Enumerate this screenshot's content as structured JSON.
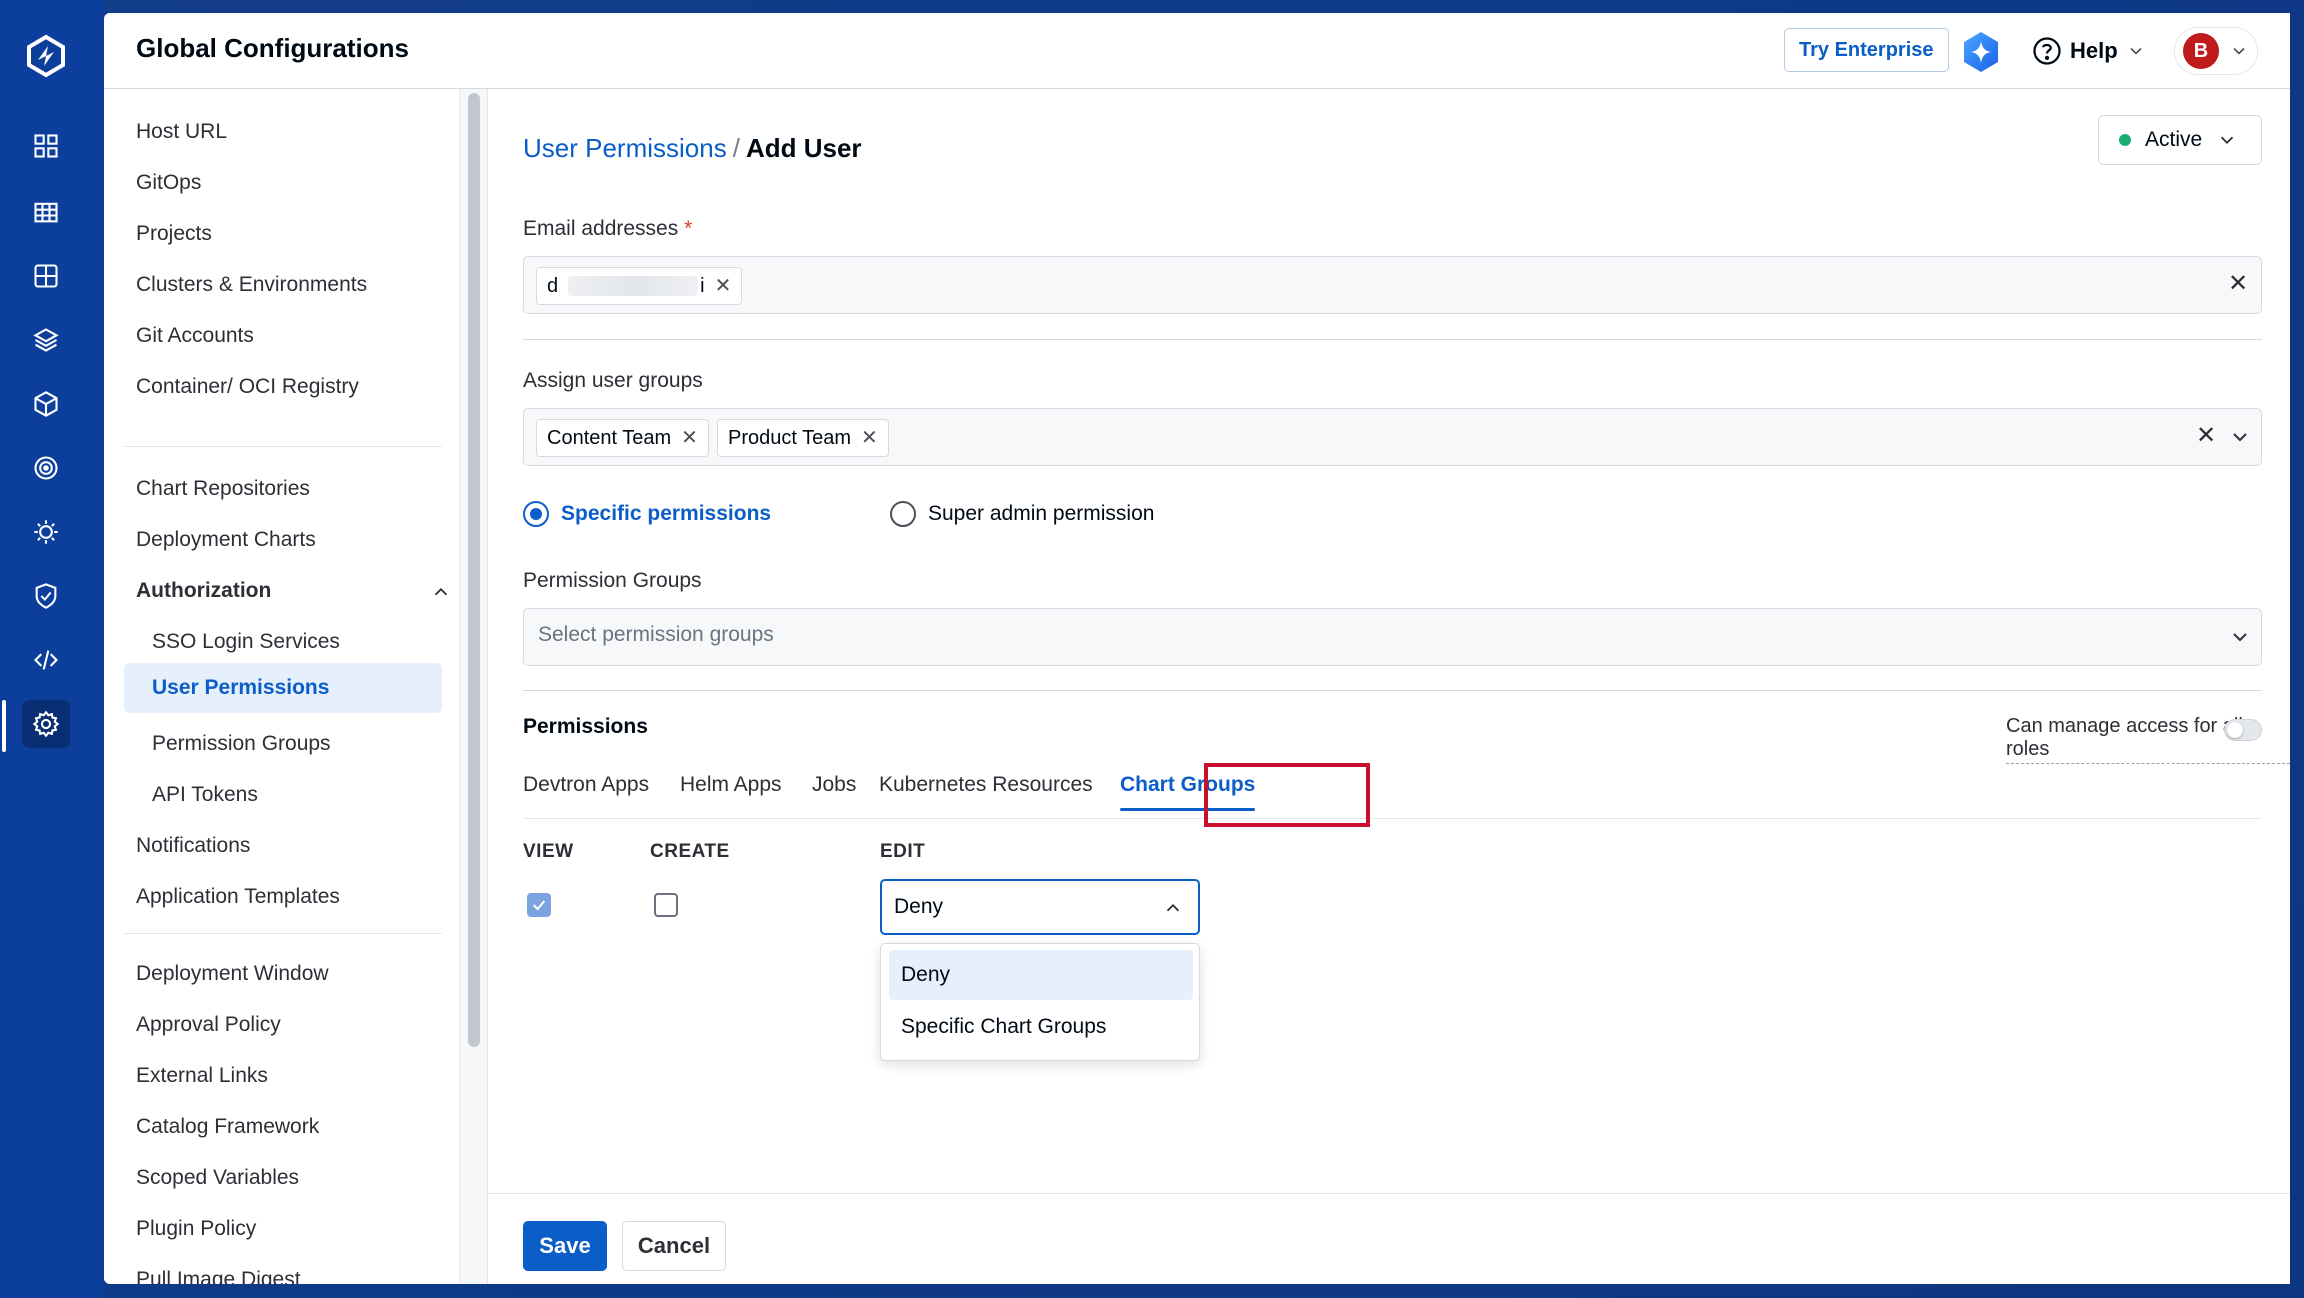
{
  "app": {
    "title": "Global Configurations",
    "try_enterprise": "Try Enterprise",
    "help": "Help",
    "avatar_initial": "B"
  },
  "rail": {
    "icons": [
      "apps-icon",
      "grid-icon",
      "dashboard-icon",
      "stack-icon",
      "cube-icon",
      "target-icon",
      "bug-icon",
      "shield-icon",
      "code-icon",
      "gear-icon"
    ]
  },
  "sidebar": {
    "items": [
      {
        "label": "Host URL"
      },
      {
        "label": "GitOps"
      },
      {
        "label": "Projects"
      },
      {
        "label": "Clusters & Environments"
      },
      {
        "label": "Git Accounts"
      },
      {
        "label": "Container/ OCI Registry"
      },
      {
        "label": "Chart Repositories"
      },
      {
        "label": "Deployment Charts"
      },
      {
        "label": "Authorization"
      },
      {
        "label": "SSO Login Services"
      },
      {
        "label": "User Permissions"
      },
      {
        "label": "Permission Groups"
      },
      {
        "label": "API Tokens"
      },
      {
        "label": "Notifications"
      },
      {
        "label": "Application Templates"
      },
      {
        "label": "Deployment Window"
      },
      {
        "label": "Approval Policy"
      },
      {
        "label": "External Links"
      },
      {
        "label": "Catalog Framework"
      },
      {
        "label": "Scoped Variables"
      },
      {
        "label": "Plugin Policy"
      },
      {
        "label": "Pull Image Digest"
      }
    ]
  },
  "breadcrumb": {
    "parent": "User Permissions",
    "separator": "/",
    "current": "Add User"
  },
  "status": {
    "label": "Active",
    "color": "#1dad70"
  },
  "email": {
    "label": "Email addresses",
    "required_mark": "*",
    "chip_start": "d",
    "chip_end": "i"
  },
  "groups": {
    "label": "Assign user groups",
    "chips": [
      "Content Team",
      "Product Team"
    ]
  },
  "permission_type": {
    "specific": "Specific permissions",
    "super_admin": "Super admin permission"
  },
  "permission_groups": {
    "label": "Permission Groups",
    "placeholder": "Select permission groups"
  },
  "permissions": {
    "title": "Permissions",
    "manage_all": "Can manage access for all roles",
    "tabs": [
      "Devtron Apps",
      "Helm Apps",
      "Jobs",
      "Kubernetes Resources",
      "Chart Groups"
    ],
    "active_tab": "Chart Groups",
    "columns": {
      "view": "VIEW",
      "create": "CREATE",
      "edit": "EDIT"
    },
    "edit_value": "Deny",
    "edit_options": [
      "Deny",
      "Specific Chart Groups"
    ]
  },
  "footer": {
    "save": "Save",
    "cancel": "Cancel"
  },
  "colors": {
    "accent": "#0b5dc8",
    "rail": "#0c3e9c",
    "highlight": "#c8102e"
  }
}
